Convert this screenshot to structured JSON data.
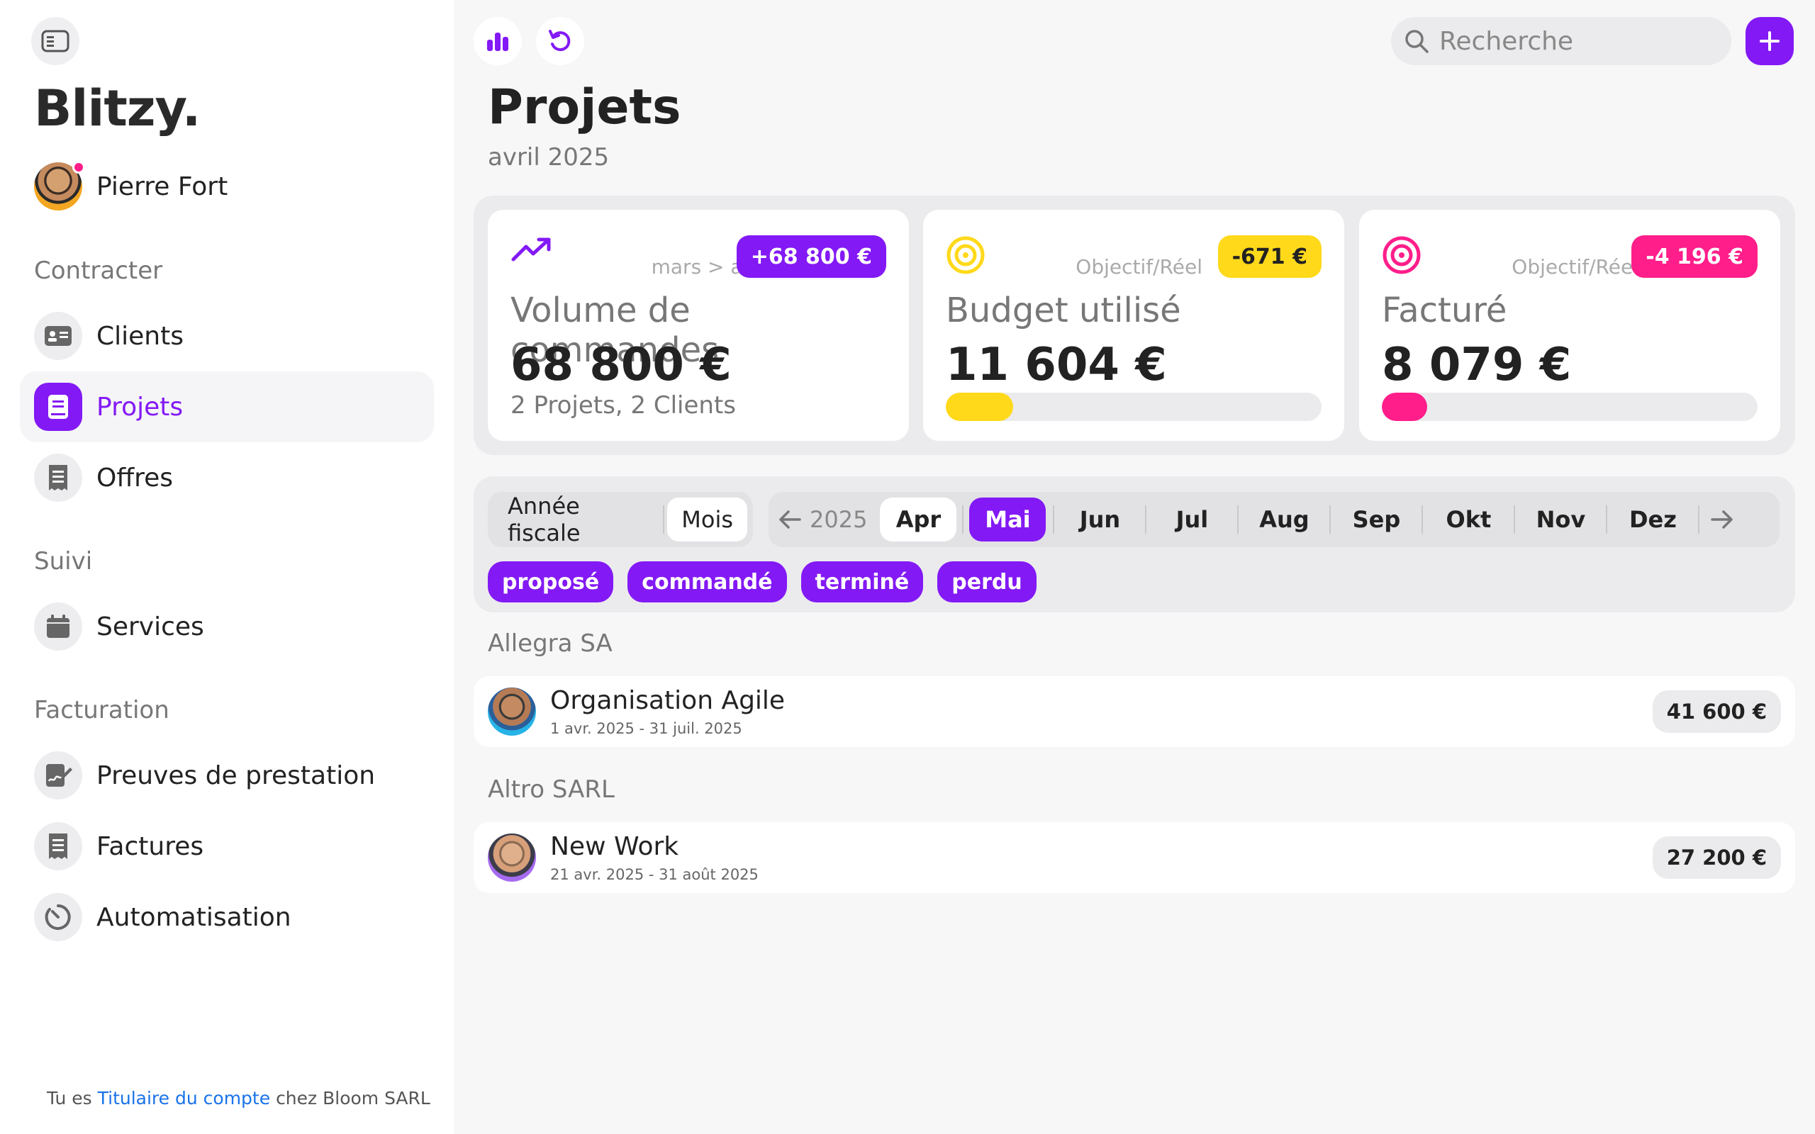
{
  "sidebar": {
    "brand": "Blitzy.",
    "user": {
      "name": "Pierre Fort"
    },
    "sections": [
      {
        "title": "Contracter",
        "items": [
          {
            "label": "Clients"
          },
          {
            "label": "Projets"
          },
          {
            "label": "Offres"
          }
        ]
      },
      {
        "title": "Suivi",
        "items": [
          {
            "label": "Services"
          }
        ]
      },
      {
        "title": "Facturation",
        "items": [
          {
            "label": "Preuves de prestation"
          },
          {
            "label": "Factures"
          },
          {
            "label": "Automatisation"
          }
        ]
      }
    ],
    "active_item": "Projets",
    "footer": {
      "prefix": "Tu es",
      "link": "Titulaire du compte",
      "suffix": "chez Bloom SARL"
    }
  },
  "toolbar": {
    "search_placeholder": "Recherche"
  },
  "header": {
    "title": "Projets",
    "subtitle": "avril 2025"
  },
  "kpis": [
    {
      "compare": "mars > avr.",
      "badge": "+68 800 €",
      "badge_color": "#8319f5",
      "title": "Volume de commandes",
      "value": "68 800 €",
      "sub": "2 Projets, 2 Clients"
    },
    {
      "compare": "Objectif/Réel",
      "badge": "-671 €",
      "badge_color": "#ffd91a",
      "title": "Budget utilisé",
      "value": "11 604 €",
      "progress": 0.18,
      "progress_color": "#ffd91a"
    },
    {
      "compare": "Objectif/Réel",
      "badge": "-4 196 €",
      "badge_color": "#ff1e8a",
      "title": "Facturé",
      "value": "8 079 €",
      "progress": 0.12,
      "progress_color": "#ff1e8a"
    }
  ],
  "filters": {
    "period_modes": [
      "Année fiscale",
      "Mois"
    ],
    "active_mode": "Mois",
    "year": "2025",
    "months": [
      "Apr",
      "Mai",
      "Jun",
      "Jul",
      "Aug",
      "Sep",
      "Okt",
      "Nov",
      "Dez"
    ],
    "highlighted_month": "Apr",
    "selected_month": "Mai",
    "statuses": [
      "proposé",
      "commandé",
      "terminé",
      "perdu"
    ]
  },
  "groups": [
    {
      "client": "Allegra SA",
      "projects": [
        {
          "name": "Organisation Agile",
          "dates": "1 avr. 2025 - 31 juil. 2025",
          "amount": "41 600 €"
        }
      ]
    },
    {
      "client": "Altro SARL",
      "projects": [
        {
          "name": "New Work",
          "dates": "21 avr. 2025 - 31 août 2025",
          "amount": "27 200 €"
        }
      ]
    }
  ],
  "colors": {
    "accent": "#8319f5",
    "yellow": "#ffd91a",
    "pink": "#ff1e8a"
  }
}
